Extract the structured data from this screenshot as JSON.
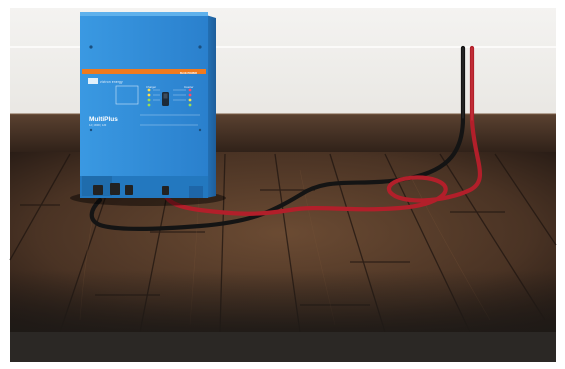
{
  "device": {
    "brand": "victron energy",
    "model": "MultiPlus",
    "subtitle": "12 | 3000 | 120",
    "section_charger": "Charger",
    "section_inverter": "Inverter",
    "strip_text": "BLUE POWER"
  },
  "colors": {
    "wall": "#f2f0ec",
    "baseboard": "#3c2a1e",
    "floor": "#4d3626",
    "device_blue": "#2f8bd6",
    "device_orange": "#f07a1e",
    "cable_red": "#b3202a",
    "cable_black": "#151515",
    "floor_shadow": "#2a2623"
  }
}
